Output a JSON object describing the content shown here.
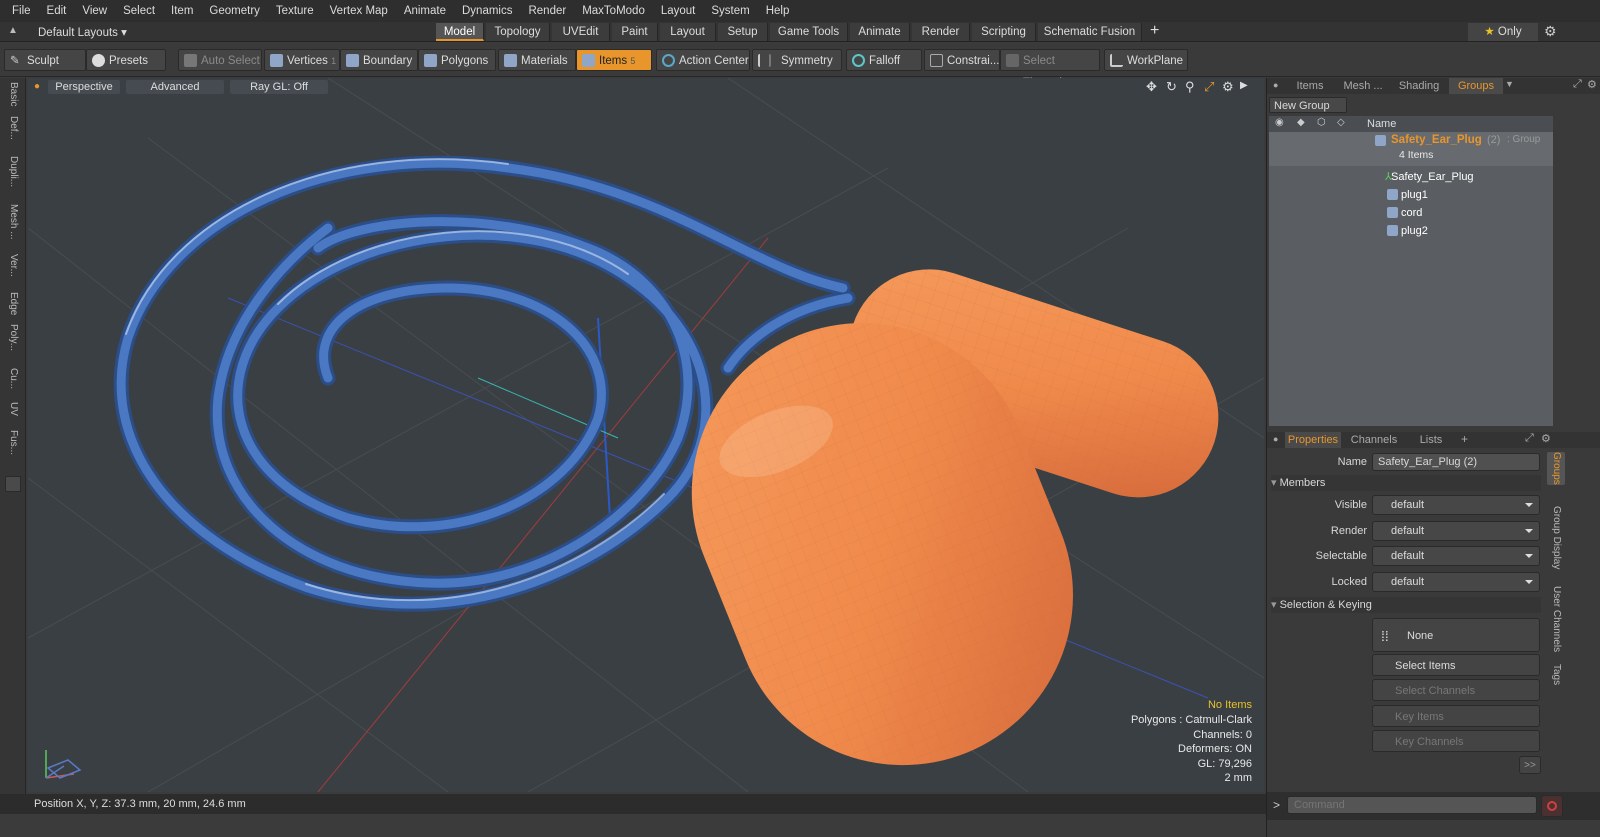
{
  "menu": [
    "File",
    "Edit",
    "View",
    "Select",
    "Item",
    "Geometry",
    "Texture",
    "Vertex Map",
    "Animate",
    "Dynamics",
    "Render",
    "MaxToModo",
    "Layout",
    "System",
    "Help"
  ],
  "layouts_label": "Default Layouts",
  "layout_tabs": [
    "Model",
    "Topology",
    "UVEdit",
    "Paint",
    "Layout",
    "Setup",
    "Game Tools",
    "Animate",
    "Render",
    "Scripting",
    "Schematic Fusion"
  ],
  "only_label": "Only",
  "toolbar": {
    "sculpt": "Sculpt",
    "presets": "Presets",
    "auto_select": "Auto Select",
    "vertices": "Vertices",
    "vertices_count": "1",
    "boundary": "Boundary",
    "polygons": "Polygons",
    "materials": "Materials",
    "items": "Items",
    "items_count": "5",
    "action_center": "Action Center",
    "symmetry": "Symmetry",
    "falloff": "Falloff",
    "constraints": "Constrai...",
    "select_through": "Select Through",
    "workplane": "WorkPlane"
  },
  "left_tabs": [
    "Basic",
    "Def...",
    "Dupli...",
    "Mesh ...",
    "Ver...",
    "Edge",
    "Poly...",
    "Cu...",
    "UV",
    "Fus..."
  ],
  "viewport": {
    "perspective": "Perspective",
    "advanced": "Advanced",
    "raygl": "Ray GL: Off",
    "info": {
      "no_items": "No Items",
      "polygons": "Polygons : Catmull-Clark",
      "channels": "Channels: 0",
      "deformers": "Deformers: ON",
      "gl": "GL: 79,296",
      "scale": "2 mm"
    }
  },
  "status": "Position X, Y, Z:  37.3 mm, 20 mm, 24.6 mm",
  "right_top_tabs": [
    "Items",
    "Mesh ...",
    "Shading",
    "Groups"
  ],
  "new_group": "New Group",
  "name_header": "Name",
  "group": {
    "name": "Safety_Ear_Plug",
    "suffix": "(2)",
    "type": ": Group",
    "count": "4 Items",
    "children": [
      "Safety_Ear_Plug",
      "plug1",
      "cord",
      "plug2"
    ]
  },
  "prop_tabs": [
    "Properties",
    "Channels",
    "Lists"
  ],
  "side_tabs": [
    "Groups",
    "Group Display",
    "User Channels",
    "Tags"
  ],
  "props": {
    "name_label": "Name",
    "name_value": "Safety_Ear_Plug (2)",
    "members": "Members",
    "visible": "Visible",
    "render": "Render",
    "selectable": "Selectable",
    "locked": "Locked",
    "default": "default",
    "selection_keying": "Selection & Keying",
    "none": "None",
    "select_items": "Select Items",
    "select_channels": "Select Channels",
    "key_items": "Key Items",
    "key_channels": "Key Channels",
    "more": ">>"
  },
  "command_placeholder": "Command",
  "colors": {
    "accent": "#e8962c",
    "plug": "#f08a4b",
    "cord": "#3e6bb0",
    "viewport": "#3a3f44"
  }
}
